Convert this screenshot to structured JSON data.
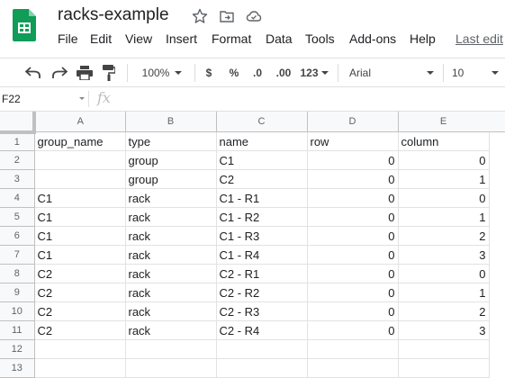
{
  "header": {
    "title": "racks-example",
    "menu": [
      "File",
      "Edit",
      "View",
      "Insert",
      "Format",
      "Data",
      "Tools",
      "Add-ons",
      "Help"
    ],
    "last_edit": "Last edit"
  },
  "toolbar": {
    "zoom": "100%",
    "currency": "$",
    "percent": "%",
    "decrease_decimals": ".0",
    "increase_decimals": ".00",
    "more_formats": "123",
    "font": "Arial",
    "font_size": "10"
  },
  "formula_bar": {
    "name_box": "F22",
    "fx": "fx",
    "value": ""
  },
  "sheet": {
    "columns": [
      "A",
      "B",
      "C",
      "D",
      "E"
    ],
    "rows": [
      {
        "num": "1",
        "cells": [
          "group_name",
          "type",
          "name",
          "row",
          "column"
        ]
      },
      {
        "num": "2",
        "cells": [
          "",
          "group",
          "C1",
          "0",
          "0"
        ]
      },
      {
        "num": "3",
        "cells": [
          "",
          "group",
          "C2",
          "0",
          "1"
        ]
      },
      {
        "num": "4",
        "cells": [
          "C1",
          "rack",
          "C1 - R1",
          "0",
          "0"
        ]
      },
      {
        "num": "5",
        "cells": [
          "C1",
          "rack",
          "C1 - R2",
          "0",
          "1"
        ]
      },
      {
        "num": "6",
        "cells": [
          "C1",
          "rack",
          "C1 - R3",
          "0",
          "2"
        ]
      },
      {
        "num": "7",
        "cells": [
          "C1",
          "rack",
          "C1 - R4",
          "0",
          "3"
        ]
      },
      {
        "num": "8",
        "cells": [
          "C2",
          "rack",
          "C2 - R1",
          "0",
          "0"
        ]
      },
      {
        "num": "9",
        "cells": [
          "C2",
          "rack",
          "C2 - R2",
          "0",
          "1"
        ]
      },
      {
        "num": "10",
        "cells": [
          "C2",
          "rack",
          "C2 - R3",
          "0",
          "2"
        ]
      },
      {
        "num": "11",
        "cells": [
          "C2",
          "rack",
          "C2 - R4",
          "0",
          "3"
        ]
      },
      {
        "num": "12",
        "cells": [
          "",
          "",
          "",
          "",
          ""
        ]
      },
      {
        "num": "13",
        "cells": [
          "",
          "",
          "",
          "",
          ""
        ]
      }
    ]
  },
  "colors": {
    "logo_green": "#0f9d58",
    "header_bg": "#f8f9fa",
    "gridline": "#e2e2e2"
  }
}
